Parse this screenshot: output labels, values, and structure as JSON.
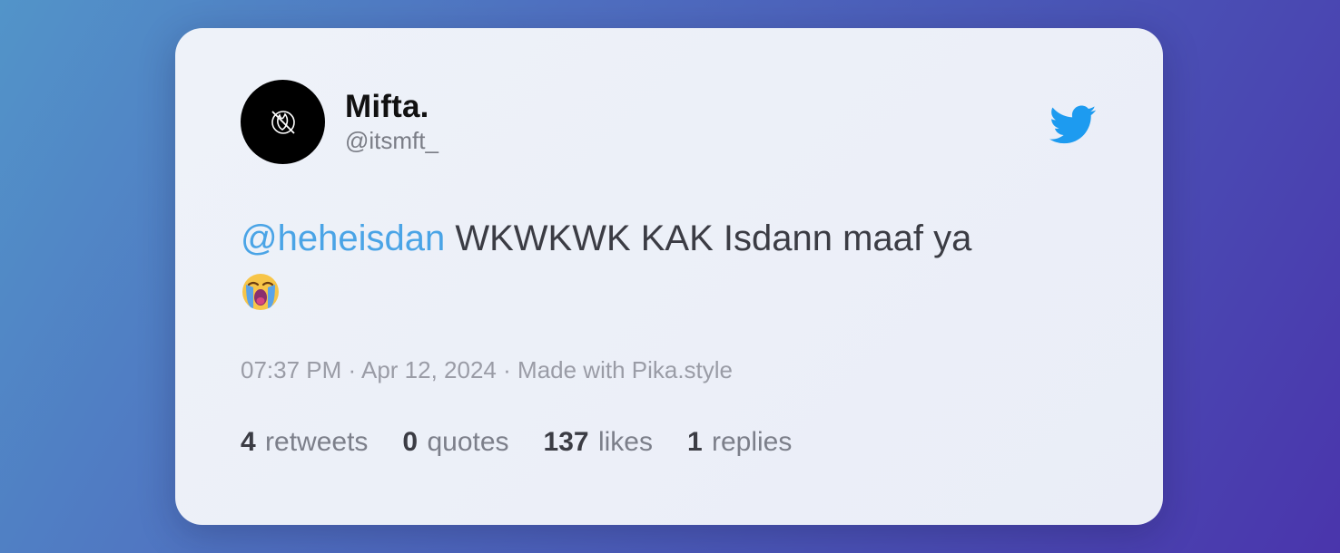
{
  "tweet": {
    "author_name": "Mifta.",
    "author_handle": "@itsmft_",
    "mention": "@heheisdan",
    "text": " WKWKWK KAK Isdann maaf ya",
    "emoji_name": "loudly-crying-face-emoji",
    "time": "07:37 PM",
    "separator": "·",
    "date": "Apr 12, 2024",
    "credit": "Made with Pika.style"
  },
  "stats": [
    {
      "value": "4",
      "label": "retweets"
    },
    {
      "value": "0",
      "label": "quotes"
    },
    {
      "value": "137",
      "label": "likes"
    },
    {
      "value": "1",
      "label": "replies"
    }
  ],
  "icons": {
    "brand": "twitter-bird-icon",
    "avatar": "avatar-logo-icon"
  },
  "colors": {
    "mention": "#4aa4e6",
    "twitter_blue": "#1d9bf0",
    "card_bg": "#edf0f8"
  }
}
